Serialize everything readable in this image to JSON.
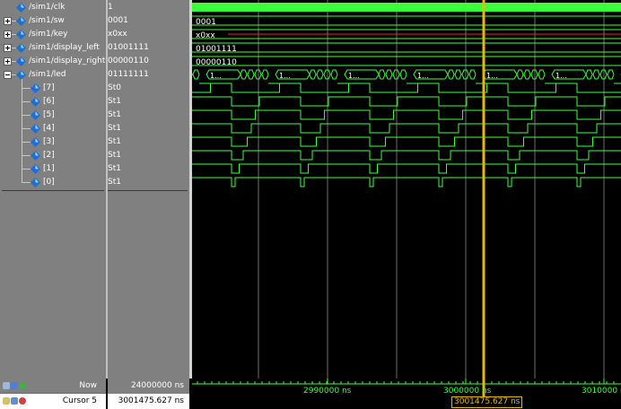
{
  "colors": {
    "wave": "#3cff3c",
    "bus_fill": "#000000",
    "grid": "#6e6e6e",
    "cursor": "#e6b800",
    "key_x": "#ff2020"
  },
  "signals": [
    {
      "id": "clk",
      "name": "/sim1/clk",
      "value": "1",
      "expand": "none",
      "indent": 0,
      "kind": "clk"
    },
    {
      "id": "sw",
      "name": "/sim1/sw",
      "value": "0001",
      "expand": "plus",
      "indent": 0,
      "kind": "bus",
      "wave_label": "0001"
    },
    {
      "id": "key",
      "name": "/sim1/key",
      "value": "x0xx",
      "expand": "plus",
      "indent": 0,
      "kind": "bus_x",
      "wave_label": "x0xx"
    },
    {
      "id": "display_left",
      "name": "/sim1/display_left",
      "value": "01001111",
      "expand": "plus",
      "indent": 0,
      "kind": "bus",
      "wave_label": "01001111"
    },
    {
      "id": "display_right",
      "name": "/sim1/display_right",
      "value": "00000110",
      "expand": "plus",
      "indent": 0,
      "kind": "bus",
      "wave_label": "00000110"
    },
    {
      "id": "led",
      "name": "/sim1/led",
      "value": "01111111",
      "expand": "minus",
      "indent": 0,
      "kind": "led_bus"
    },
    {
      "id": "led7",
      "name": "[7]",
      "value": "St0",
      "expand": "none",
      "indent": 1,
      "kind": "bit",
      "bit": 7
    },
    {
      "id": "led6",
      "name": "[6]",
      "value": "St1",
      "expand": "none",
      "indent": 1,
      "kind": "bit",
      "bit": 6
    },
    {
      "id": "led5",
      "name": "[5]",
      "value": "St1",
      "expand": "none",
      "indent": 1,
      "kind": "bit",
      "bit": 5
    },
    {
      "id": "led4",
      "name": "[4]",
      "value": "St1",
      "expand": "none",
      "indent": 1,
      "kind": "bit",
      "bit": 4
    },
    {
      "id": "led3",
      "name": "[3]",
      "value": "St1",
      "expand": "none",
      "indent": 1,
      "kind": "bit",
      "bit": 3
    },
    {
      "id": "led2",
      "name": "[2]",
      "value": "St1",
      "expand": "none",
      "indent": 1,
      "kind": "bit",
      "bit": 2
    },
    {
      "id": "led1",
      "name": "[1]",
      "value": "St1",
      "expand": "none",
      "indent": 1,
      "kind": "bit",
      "bit": 1
    },
    {
      "id": "led0",
      "name": "[0]",
      "value": "St1",
      "expand": "none",
      "indent": 1,
      "kind": "bit",
      "bit": 0
    }
  ],
  "led_bus_label": "1...",
  "bottom": {
    "now_label": "Now",
    "now_value": "24000000 ns",
    "cursor_label": "Cursor 5",
    "cursor_value": "3001475.627 ns"
  },
  "timeline": {
    "ticks": [
      "2990000 ns",
      "3000000 ns",
      "3010000 ns"
    ],
    "cursor_time": "3001475.627 ns"
  }
}
